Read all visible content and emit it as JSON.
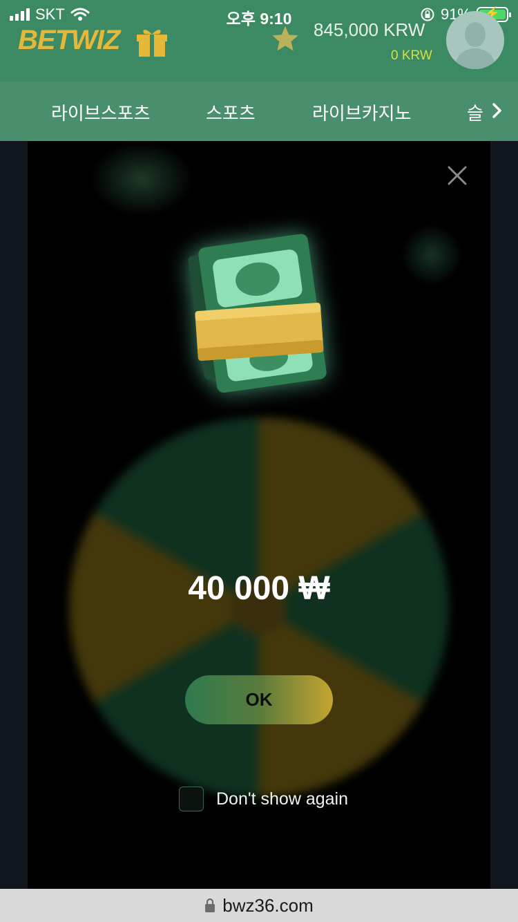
{
  "status_bar": {
    "carrier": "SKT",
    "time": "오후 9:10",
    "battery": "91%"
  },
  "header": {
    "logo": "BETWIZ",
    "balance": "845,000 KRW",
    "bonus_balance": "0 KRW"
  },
  "nav": {
    "tabs": [
      {
        "label": "라이브스포츠"
      },
      {
        "label": "스포츠"
      },
      {
        "label": "라이브카지노"
      },
      {
        "label": "슬"
      }
    ]
  },
  "popup": {
    "amount": "40 000 ₩",
    "ok_label": "OK",
    "dont_show_label": "Don't show again",
    "dont_show_checked": false
  },
  "browser": {
    "url": "bwz36.com"
  },
  "colors": {
    "header_bg": "#3c8a63",
    "nav_bg": "#4a8f6d",
    "logo": "#e6b83a",
    "bonus": "#d6e03c",
    "button_start": "#2f7a4e",
    "button_end": "#c5a530"
  }
}
